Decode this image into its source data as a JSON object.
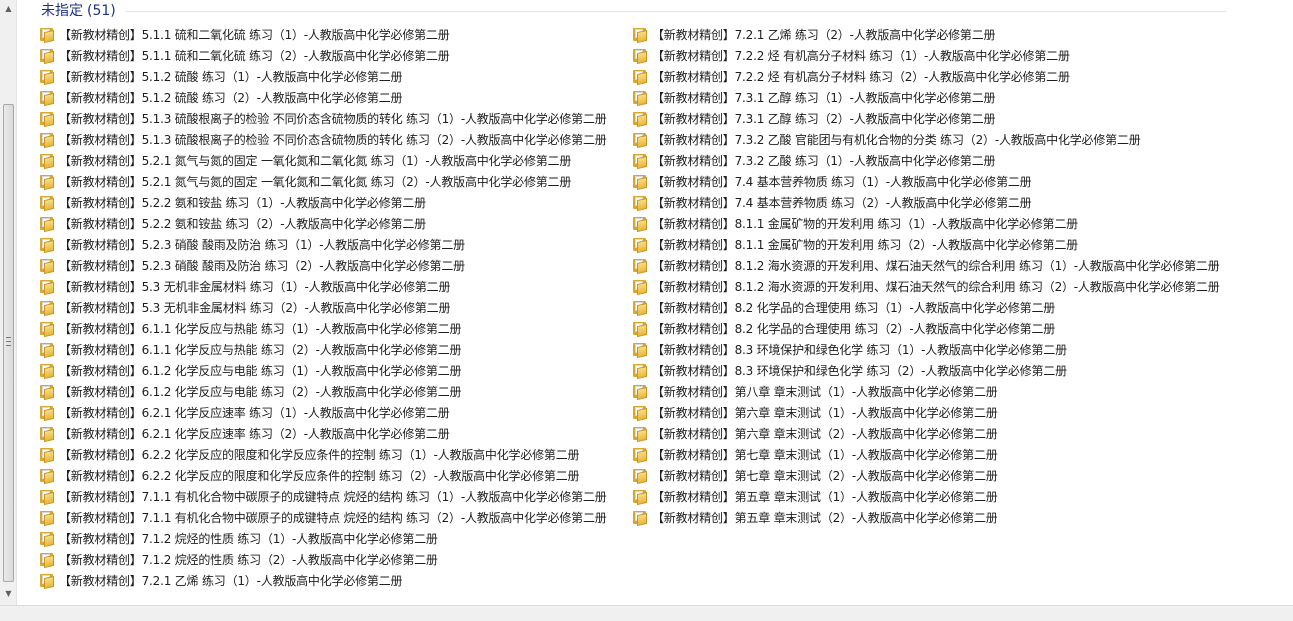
{
  "group": {
    "title": "未指定",
    "count": "(51)"
  },
  "left_items": [
    "【新教材精创】5.1.1 硫和二氧化硫 练习（1）-人教版高中化学必修第二册",
    "【新教材精创】5.1.1 硫和二氧化硫 练习（2）-人教版高中化学必修第二册",
    "【新教材精创】5.1.2 硫酸 练习（1）-人教版高中化学必修第二册",
    "【新教材精创】5.1.2 硫酸 练习（2）-人教版高中化学必修第二册",
    "【新教材精创】5.1.3 硫酸根离子的检验 不同价态含硫物质的转化 练习（1）-人教版高中化学必修第二册",
    "【新教材精创】5.1.3 硫酸根离子的检验 不同价态含硫物质的转化 练习（2）-人教版高中化学必修第二册",
    "【新教材精创】5.2.1 氮气与氮的固定 一氧化氮和二氧化氮 练习（1）-人教版高中化学必修第二册",
    "【新教材精创】5.2.1 氮气与氮的固定 一氧化氮和二氧化氮 练习（2）-人教版高中化学必修第二册",
    "【新教材精创】5.2.2 氨和铵盐 练习（1）-人教版高中化学必修第二册",
    "【新教材精创】5.2.2 氨和铵盐 练习（2）-人教版高中化学必修第二册",
    "【新教材精创】5.2.3 硝酸 酸雨及防治 练习（1）-人教版高中化学必修第二册",
    "【新教材精创】5.2.3 硝酸 酸雨及防治 练习（2）-人教版高中化学必修第二册",
    "【新教材精创】5.3 无机非金属材料 练习（1）-人教版高中化学必修第二册",
    "【新教材精创】5.3 无机非金属材料 练习（2）-人教版高中化学必修第二册",
    "【新教材精创】6.1.1 化学反应与热能 练习（1）-人教版高中化学必修第二册",
    "【新教材精创】6.1.1 化学反应与热能 练习（2）-人教版高中化学必修第二册",
    "【新教材精创】6.1.2 化学反应与电能 练习（1）-人教版高中化学必修第二册",
    "【新教材精创】6.1.2 化学反应与电能 练习（2）-人教版高中化学必修第二册",
    "【新教材精创】6.2.1 化学反应速率 练习（1）-人教版高中化学必修第二册",
    "【新教材精创】6.2.1 化学反应速率 练习（2）-人教版高中化学必修第二册",
    "【新教材精创】6.2.2 化学反应的限度和化学反应条件的控制 练习（1）-人教版高中化学必修第二册",
    "【新教材精创】6.2.2 化学反应的限度和化学反应条件的控制 练习（2）-人教版高中化学必修第二册",
    "【新教材精创】7.1.1 有机化合物中碳原子的成键特点 烷烃的结构 练习（1）-人教版高中化学必修第二册",
    "【新教材精创】7.1.1 有机化合物中碳原子的成键特点 烷烃的结构 练习（2）-人教版高中化学必修第二册",
    "【新教材精创】7.1.2 烷烃的性质 练习（1）-人教版高中化学必修第二册",
    "【新教材精创】7.1.2 烷烃的性质 练习（2）-人教版高中化学必修第二册",
    "【新教材精创】7.2.1 乙烯 练习（1）-人教版高中化学必修第二册"
  ],
  "right_items": [
    "【新教材精创】7.2.1 乙烯 练习（2）-人教版高中化学必修第二册",
    "【新教材精创】7.2.2 烃 有机高分子材料 练习（1）-人教版高中化学必修第二册",
    "【新教材精创】7.2.2 烃 有机高分子材料 练习（2）-人教版高中化学必修第二册",
    "【新教材精创】7.3.1 乙醇 练习（1）-人教版高中化学必修第二册",
    "【新教材精创】7.3.1 乙醇 练习（2）-人教版高中化学必修第二册",
    "【新教材精创】7.3.2 乙酸 官能团与有机化合物的分类 练习（2）-人教版高中化学必修第二册",
    "【新教材精创】7.3.2 乙酸 练习（1）-人教版高中化学必修第二册",
    "【新教材精创】7.4 基本营养物质 练习（1）-人教版高中化学必修第二册",
    "【新教材精创】7.4 基本营养物质 练习（2）-人教版高中化学必修第二册",
    "【新教材精创】8.1.1 金属矿物的开发利用 练习（1）-人教版高中化学必修第二册",
    "【新教材精创】8.1.1 金属矿物的开发利用 练习（2）-人教版高中化学必修第二册",
    "【新教材精创】8.1.2 海水资源的开发利用、煤石油天然气的综合利用 练习（1）-人教版高中化学必修第二册",
    "【新教材精创】8.1.2 海水资源的开发利用、煤石油天然气的综合利用 练习（2）-人教版高中化学必修第二册",
    "【新教材精创】8.2 化学品的合理使用 练习（1）-人教版高中化学必修第二册",
    "【新教材精创】8.2 化学品的合理使用 练习（2）-人教版高中化学必修第二册",
    "【新教材精创】8.3 环境保护和绿色化学 练习（1）-人教版高中化学必修第二册",
    "【新教材精创】8.3 环境保护和绿色化学 练习（2）-人教版高中化学必修第二册",
    "【新教材精创】第八章 章末测试（1）-人教版高中化学必修第二册",
    "【新教材精创】第六章 章末测试（1）-人教版高中化学必修第二册",
    "【新教材精创】第六章 章末测试（2）-人教版高中化学必修第二册",
    "【新教材精创】第七章 章末测试（1）-人教版高中化学必修第二册",
    "【新教材精创】第七章 章末测试（2）-人教版高中化学必修第二册",
    "【新教材精创】第五章 章末测试（1）-人教版高中化学必修第二册",
    "【新教材精创】第五章 章末测试（2）-人教版高中化学必修第二册"
  ],
  "icons": {
    "item": "folder-icon",
    "scroll_up": "arrow-up-icon",
    "scroll_down": "arrow-down-icon"
  },
  "colors": {
    "group_title": "#1e3287",
    "folder": "#e8b73c"
  }
}
